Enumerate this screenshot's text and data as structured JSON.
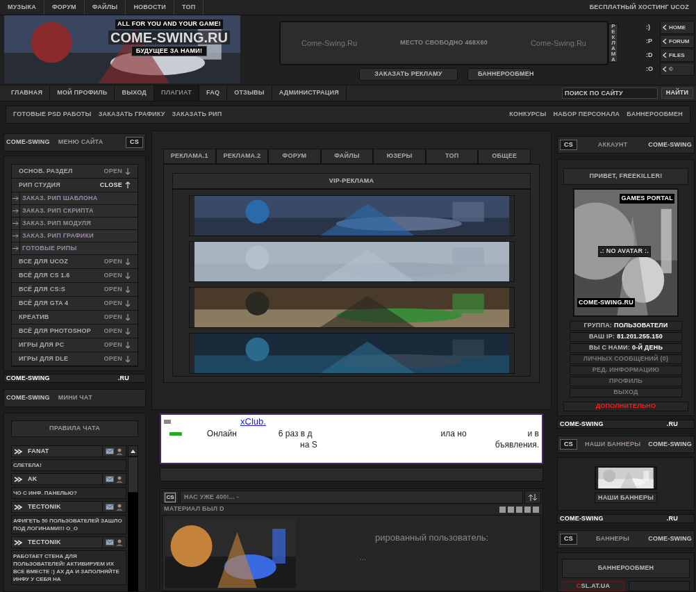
{
  "top_menu": [
    "МУЗЫКА",
    "ФОРУМ",
    "ФАЙЛЫ",
    "НОВОСТИ",
    "ТОП"
  ],
  "hosting_link": "БЕСПЛАТНЫЙ ХОСТИНГ UCOZ",
  "logo": {
    "tagline": "ALL FOR YOU AND YOUR GAME!",
    "title": "COME-SWING.RU",
    "slogan": "БУДУЩЕЕ ЗА НАМИ!"
  },
  "ad_slot": {
    "left": "Come-Swing.Ru",
    "center": "МЕСТО СВОБОДНО 468X60",
    "right": "Come-Swing.Ru",
    "side_label": "РЕКЛАМА"
  },
  "ad_buttons": [
    "ЗАКАЗАТЬ РЕКЛАМУ",
    "БАННЕРООБМЕН"
  ],
  "quick_nav": [
    {
      "smiley": ":)",
      "label": "HOME"
    },
    {
      "smiley": ":P",
      "label": "FORUM"
    },
    {
      "smiley": ":D",
      "label": "FILES"
    },
    {
      "smiley": ":O",
      "label": "©"
    }
  ],
  "main_nav": [
    {
      "label": "ГЛАВНАЯ",
      "selected": false
    },
    {
      "label": "МОЙ ПРОФИЛЬ",
      "selected": false
    },
    {
      "label": "ВЫХОД",
      "selected": false
    },
    {
      "label": "ПЛАГИАТ",
      "selected": true
    },
    {
      "label": "FAQ",
      "selected": false
    },
    {
      "label": "ОТЗЫВЫ",
      "selected": false
    },
    {
      "label": "АДМИНИСТРАЦИЯ",
      "selected": false
    }
  ],
  "search": {
    "placeholder": "ПОИСК ПО САЙТУ",
    "button": "НАЙТИ"
  },
  "sub_nav": {
    "left": [
      "ГОТОВЫЕ PSD РАБОТЫ",
      "ЗАКАЗАТЬ ГРАФИКУ",
      "ЗАКАЗАТЬ РИП"
    ],
    "right": [
      "КОНКУРСЫ",
      "НАБОР ПЕРСОНАЛА",
      "БАННЕРООБМЕН"
    ]
  },
  "left_menu": {
    "header": {
      "brand": "COME-SWING",
      "title": "МЕНЮ САЙТА",
      "badge": "CS"
    },
    "items": [
      {
        "label": "ОСНОВ. РАЗДЕЛ",
        "action": "OPEN",
        "expanded": false
      },
      {
        "label": "РИП СТУДИЯ",
        "action": "CLOSE",
        "expanded": true,
        "children": [
          {
            "label": "ЗАКАЗ. РИП ШАБЛОНА"
          },
          {
            "label": "ЗАКАЗ. РИП СКРИПТА"
          },
          {
            "label": "ЗАКАЗ. РИП МОДУЛЯ"
          },
          {
            "label": "ЗАКАЗ. РИП ГРАФИКИ"
          },
          {
            "label": "ГОТОВЫЕ РИПЫ"
          }
        ]
      },
      {
        "label": "ВСЕ ДЛЯ UCOZ",
        "action": "OPEN",
        "expanded": false
      },
      {
        "label": "ВСЁ ДЛЯ CS 1.6",
        "action": "OPEN",
        "expanded": false
      },
      {
        "label": "ВСЁ ДЛЯ CS:S",
        "action": "OPEN",
        "expanded": false
      },
      {
        "label": "ВСЁ ДЛЯ GTA 4",
        "action": "OPEN",
        "expanded": false
      },
      {
        "label": "КРЕАТИВ",
        "action": "OPEN",
        "expanded": false
      },
      {
        "label": "ВСЁ ДЛЯ PHOTOSHOP",
        "action": "OPEN",
        "expanded": false
      },
      {
        "label": "ИГРЫ ДЛЯ PC",
        "action": "OPEN",
        "expanded": false
      },
      {
        "label": "ИГРЫ ДЛЯ DLE",
        "action": "OPEN",
        "expanded": false
      }
    ],
    "footer": {
      "brand": "COME-SWING",
      "domain": ".RU"
    }
  },
  "mini_chat": {
    "header": {
      "brand": "COME-SWING",
      "title": "МИНИ ЧАТ"
    },
    "rules_button": "ПРАВИЛА ЧАТА",
    "messages": [
      {
        "user": "FANAT",
        "text": "СЛЕТЕЛА!"
      },
      {
        "user": "AK",
        "text": "ЧО С ИНФ. ПАНЕЛЬЮ?"
      },
      {
        "user": "TECTONIK",
        "text": "АФИГЕТЬ 50 ПОЛЬЗОВАТЕЛЕЙ ЗАШЛО ПОД ЛОГИНАМИ!!! O_O"
      },
      {
        "user": "TECTONIK",
        "text": "РАБОТАЕТ СТЕНА ДЛЯ ПОЛЬЗОВАТЕЛЕЙ! АКТИВИРУЕМ ИХ ВСЕ ВМЕСТЕ :) АХ ДА И ЗАПОЛНЯЙТЕ ИНФУ У СЕБЯ НА"
      }
    ]
  },
  "tabs": [
    "РЕКЛАМА.1",
    "РЕКЛАМА.2",
    "ФОРУМ",
    "ФАЙЛЫ",
    "ЮЗЕРЫ",
    "ТОП",
    "ОБЩЕЕ"
  ],
  "vip": {
    "title": "VIP-РЕКЛАМА"
  },
  "text_ad": {
    "link": "xClub.",
    "line_1": [
      "Онлайн",
      "6 раз в д",
      "ила но",
      "и в"
    ],
    "line_2": [
      "на S",
      "бъявления."
    ]
  },
  "news": {
    "badge": "CS",
    "title": "НАС УЖЕ 400!... -",
    "material": "МАТЕРИАЛ БЫЛ D",
    "text": "рированный пользователь:",
    "more": "..."
  },
  "account": {
    "header": {
      "badge": "CS",
      "title": "АККАУНТ",
      "brand": "COME-SWING"
    },
    "greeting": "ПРИВЕТ, FREEKILLER!",
    "avatar": {
      "top": "GAMES PORTAL",
      "center": ".: NO AVATAR :.",
      "bottom": "COME-SWING.RU"
    },
    "rows": [
      {
        "kind": "info",
        "label": "ГРУППА:",
        "value": "ПОЛЬЗОВАТЕЛИ"
      },
      {
        "kind": "info",
        "label": "ВАШ IP:",
        "value": "81.201.255.150"
      },
      {
        "kind": "info",
        "label": "ВЫ С НАМИ:",
        "value": "0-Й ДЕНЬ"
      },
      {
        "kind": "link",
        "label": "ЛИЧНЫХ СООБЩЕНИЙ (0)"
      },
      {
        "kind": "link",
        "label": "РЕД. ИНФОРМАЦИЮ"
      },
      {
        "kind": "link",
        "label": "ПРОФИЛЬ"
      },
      {
        "kind": "link",
        "label": "ВЫХОД"
      }
    ],
    "extra": "ДОПОЛНИТЕЛЬНО",
    "footer": {
      "brand": "COME-SWING",
      "domain": ".RU"
    }
  },
  "banners_block": {
    "header": {
      "badge": "CS",
      "title": "НАШИ БАННЕРЫ",
      "brand": "COME-SWING"
    },
    "button": "НАШИ БАННЕРЫ",
    "footer": {
      "brand": "COME-SWING",
      "domain": ".RU"
    }
  },
  "exchange_block": {
    "header": {
      "badge": "CS",
      "title": "БАННЕРЫ",
      "brand": "COME-SWING"
    },
    "title": "БАННЕРООБМЕН",
    "link": "CSL.AT.UA"
  }
}
